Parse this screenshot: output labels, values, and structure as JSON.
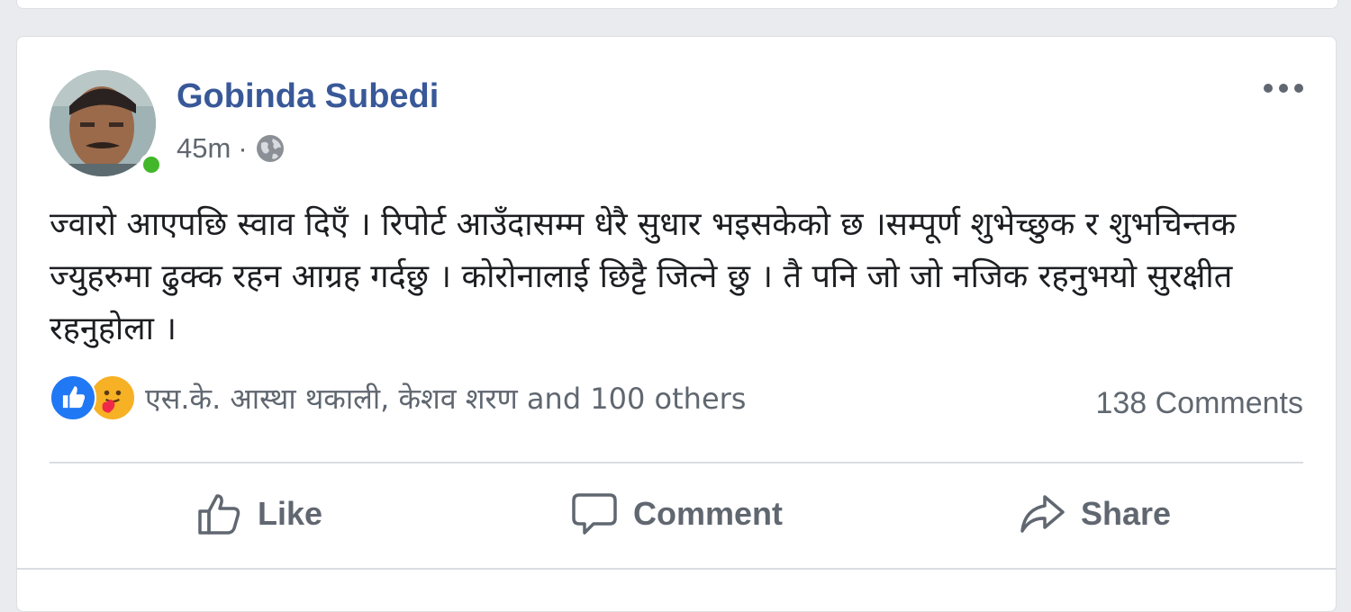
{
  "post": {
    "author": "Gobinda Subedi",
    "time": "45m",
    "separator": "·",
    "privacy_icon": "globe-icon",
    "more_icon": "more-options-icon",
    "text": "ज्वारो आएपछि स्वाव दिएँ । रिपोर्ट आउँदासम्म धेरै सुधार भइसकेको छ ।सम्पूर्ण शुभेच्छुक र शुभचिन्तक ज्युहरुमा ढुक्क रहन आग्रह गर्दछु । कोरोनालाई छिट्टै जित्ने छु । तै पनि जो जो नजिक रहनुभयो सुरक्षीत रहनुहोला ।",
    "online": true
  },
  "reactions": {
    "icons": [
      "like-reaction-icon",
      "care-reaction-icon"
    ],
    "summary": "एस.के. आस्था थकाली, केशव शरण and 100 others",
    "comments": "138 Comments"
  },
  "actions": {
    "like": "Like",
    "comment": "Comment",
    "share": "Share"
  },
  "colors": {
    "author": "#385898",
    "online": "#42b72a",
    "like_blue": "#2078f4",
    "care_yellow": "#f7b125",
    "secondary_text": "#606770"
  }
}
